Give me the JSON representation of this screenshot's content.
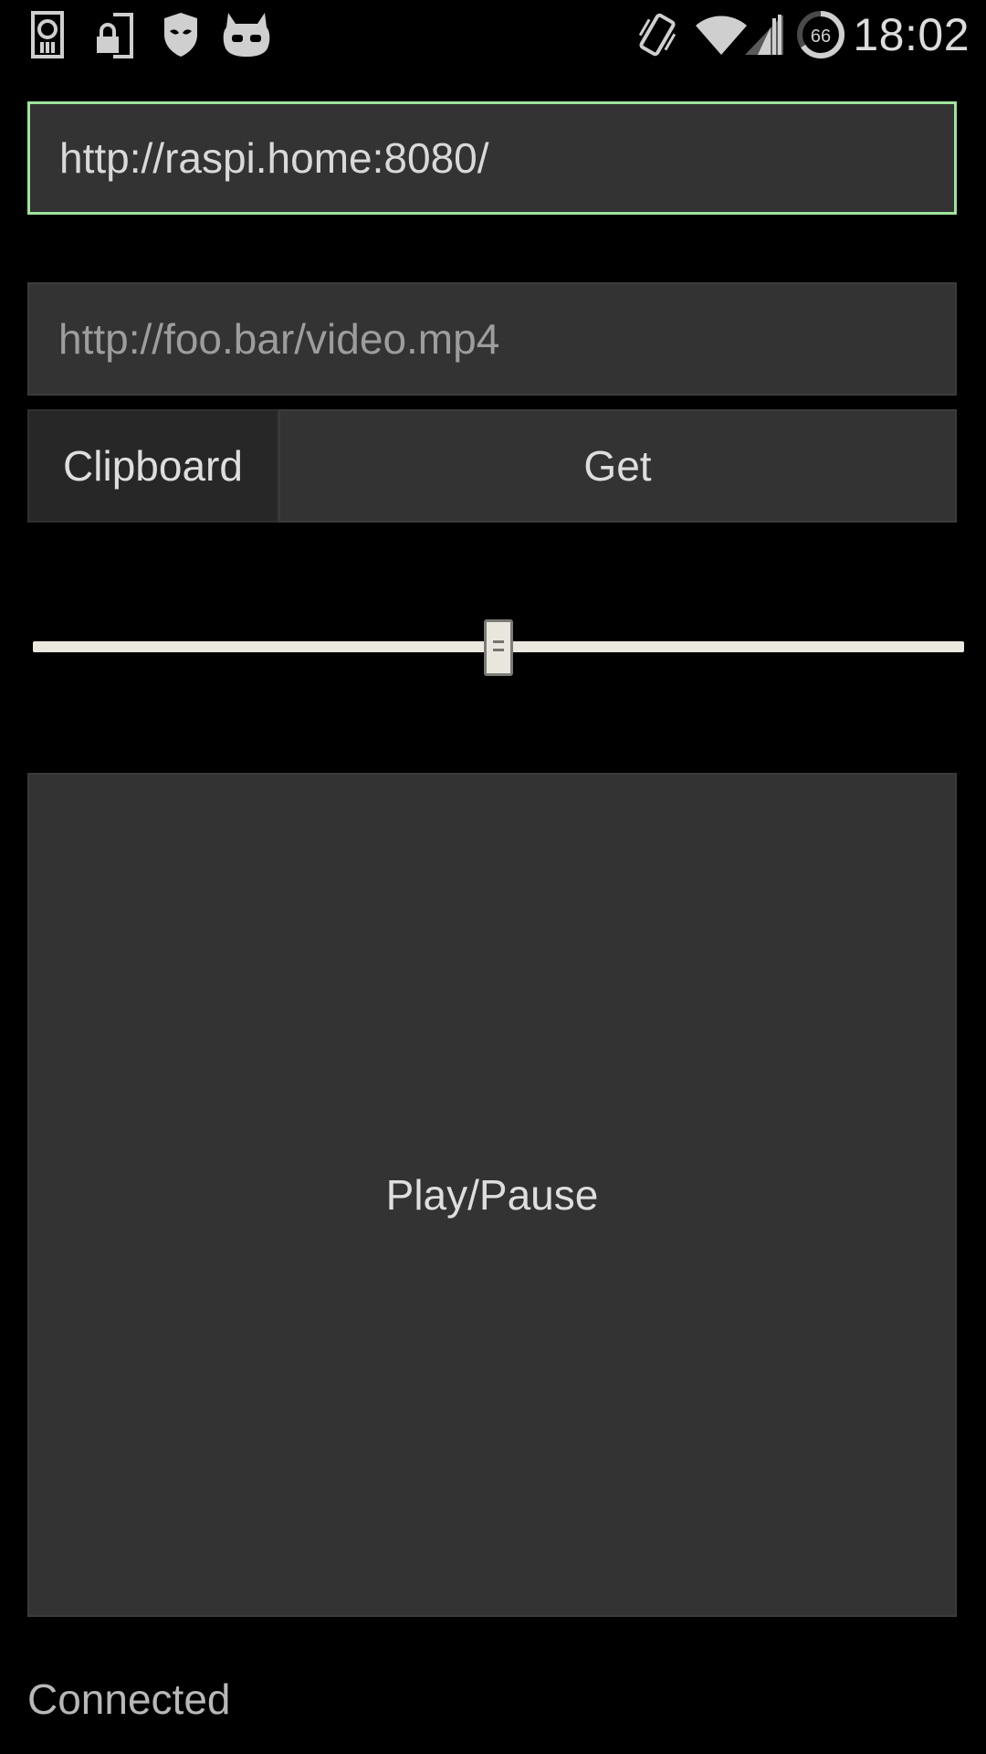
{
  "status_bar": {
    "time": "18:02",
    "battery_level": "66",
    "left_icons": [
      "sd-card-icon",
      "lock-icon",
      "privacy-guard-icon",
      "cyanogenmod-mascot-icon"
    ],
    "right_icons": [
      "vibrate-icon",
      "wifi-icon",
      "cell-signal-icon",
      "battery-icon"
    ]
  },
  "server": {
    "url_value": "http://raspi.home:8080/"
  },
  "media": {
    "url_placeholder": "http://foo.bar/video.mp4"
  },
  "actions": {
    "clipboard_label": "Clipboard",
    "get_label": "Get",
    "play_pause_label": "Play/Pause"
  },
  "seek": {
    "position_fraction": 0.5
  },
  "connection": {
    "status": "Connected"
  },
  "colors": {
    "background": "#000000",
    "surface": "#333333",
    "focus_border": "#9ee49c",
    "text": "#d9d9d9"
  }
}
